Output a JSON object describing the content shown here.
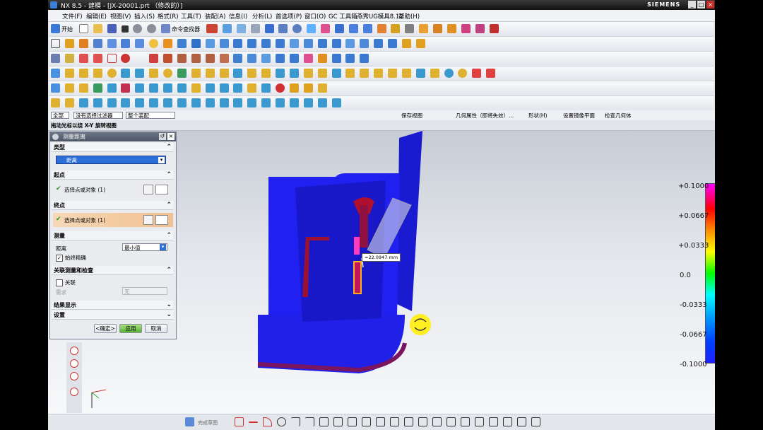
{
  "window": {
    "title": "NX 8.5 - 建模 - [JX-20001.prt （修改的）]",
    "brand": "SIEMENS",
    "min": "_",
    "max": "□",
    "close": "×"
  },
  "menu": [
    "文件(F)",
    "编辑(E)",
    "视图(V)",
    "插入(S)",
    "格式(R)",
    "工具(T)",
    "装配(A)",
    "信息(I)",
    "分析(L)",
    "首选项(P)",
    "窗口(O)",
    "GC 工具箱",
    "燕秀UG模具8.12",
    "帮助(H)"
  ],
  "toolbar1": {
    "start": "开始",
    "command_finder": "命令查找器"
  },
  "filterbar": {
    "filter_all": "全部",
    "filter_type": "没有选择过滤器",
    "assembly": "整个装配",
    "save_view": "保存视图",
    "geom_attr": "几何属性（即将失效）...",
    "shape": "形状(H)",
    "mirror_plane": "设置镜像平面",
    "check_geom": "检查几何体"
  },
  "hint": "拖动光标以绕 X-Y 旋转视图",
  "dialog": {
    "title": "测量距离",
    "sections": {
      "type": "类型",
      "start": "起点",
      "end": "终点",
      "measure": "测量",
      "assoc": "关联测量和检查",
      "result": "结果显示",
      "settings": "设置"
    },
    "type_value": "距离",
    "start_select": "选择点或对象 (1)",
    "end_select": "选择点或对象 (1)",
    "distance_label": "距离",
    "distance_value": "最小值",
    "always_precise": "始终精确",
    "assoc_label": "关联",
    "requirement_label": "需求",
    "requirement_value": "无",
    "ok": "<确定>",
    "apply": "应用",
    "cancel": "取消"
  },
  "measure_label": "=22.0947 mm",
  "legend": {
    "values": [
      "+0.1000",
      "+0.0667",
      "+0.0333",
      "0.0",
      "-0.0333",
      "-0.0667",
      "-0.1000"
    ]
  },
  "colors": {
    "part": "#2222f0",
    "accent": "#ffcc00"
  },
  "bottom": {
    "done_sketch": "完成草图"
  }
}
